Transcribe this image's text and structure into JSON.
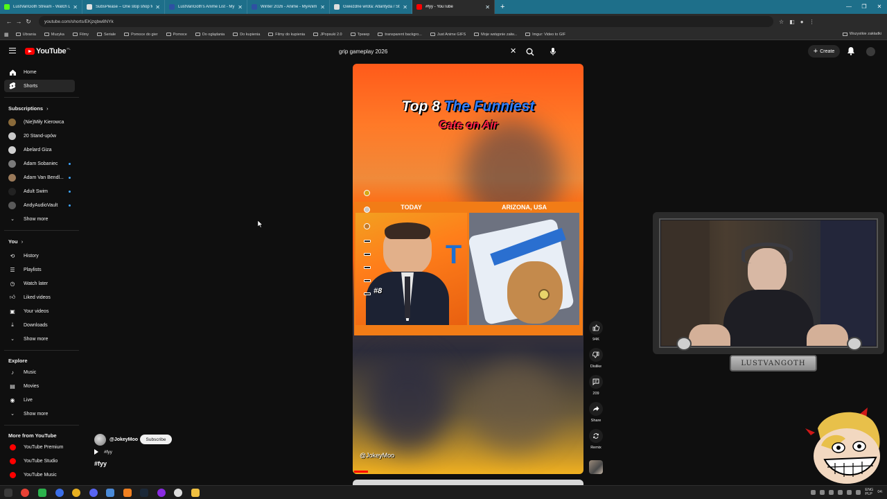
{
  "browser": {
    "tabs": [
      {
        "label": "LustVanGoth Stream - Watch Li",
        "color": "#53fc18"
      },
      {
        "label": "SubsPlease – One stop shop fo",
        "color": "#e0e0e0"
      },
      {
        "label": "LustVanGoth's Anime List - My",
        "color": "#2e51a2"
      },
      {
        "label": "Winter 2026 - Anime - MyAnim",
        "color": "#2e51a2"
      },
      {
        "label": "Gwiezdne wrota: Atlantyda / St",
        "color": "#dddddd"
      },
      {
        "label": "#fyy - YouTube",
        "color": "#ff0000"
      }
    ],
    "url": "youtube.com/shorts/EKjzqbw8NYk",
    "bookmarks": [
      "Ubrania",
      "Muzyka",
      "Filmy",
      "Seriale",
      "Pomoce do gier",
      "Pomoce",
      "Do oglądania",
      "Do kupienia",
      "Filmy do kupienia",
      "JPopsuki 2.0",
      "Трекер",
      "transparent backgro...",
      "Just Anime GIFS",
      "Moje wstępnie załw...",
      "Imgur: Video to GIF"
    ],
    "bookmarks_right": "Wszystkie zakładki"
  },
  "header": {
    "logo_text": "YouTube",
    "logo_country": "PL",
    "search_value": "grip gameplay 2026",
    "create_label": "Create"
  },
  "sidebar": {
    "main": [
      {
        "label": "Home",
        "icon": "home-icon"
      },
      {
        "label": "Shorts",
        "icon": "shorts-icon"
      }
    ],
    "subscriptions_title": "Subscriptions",
    "subscriptions": [
      {
        "label": "(Nie)Miły Kierowca",
        "color": "#8a6a3a",
        "dot": false
      },
      {
        "label": "20 Stand-upów",
        "color": "#c8c8c8",
        "dot": false
      },
      {
        "label": "Abelard Giza",
        "color": "#d0d0d0",
        "dot": false
      },
      {
        "label": "Adam Sobaniec",
        "color": "#7a7a7a",
        "dot": true
      },
      {
        "label": "Adam Van Bendl...",
        "color": "#9a7a5a",
        "dot": true
      },
      {
        "label": "Adult Swim",
        "color": "#222222",
        "dot": true
      },
      {
        "label": "AndyAudioVault",
        "color": "#5a5a5a",
        "dot": true
      }
    ],
    "show_more": "Show more",
    "you_title": "You",
    "you": [
      {
        "label": "History",
        "icon": "history-icon"
      },
      {
        "label": "Playlists",
        "icon": "playlists-icon"
      },
      {
        "label": "Watch later",
        "icon": "watch-later-icon"
      },
      {
        "label": "Liked videos",
        "icon": "liked-icon"
      },
      {
        "label": "Your videos",
        "icon": "your-videos-icon"
      },
      {
        "label": "Downloads",
        "icon": "downloads-icon"
      }
    ],
    "explore_title": "Explore",
    "explore": [
      {
        "label": "Music",
        "icon": "music-icon"
      },
      {
        "label": "Movies",
        "icon": "movies-icon"
      },
      {
        "label": "Live",
        "icon": "live-icon"
      }
    ],
    "more_title": "More from YouTube",
    "more": [
      {
        "label": "YouTube Premium"
      },
      {
        "label": "YouTube Studio"
      },
      {
        "label": "YouTube Music"
      }
    ]
  },
  "short": {
    "title_white": "Top 8",
    "title_blue": "The Funniest",
    "title_red": "Cats on Air",
    "label_left": "TODAY",
    "label_right": "ARIZONA, USA",
    "rank": "#8",
    "handle": "@JokeyMoo",
    "progress": 0.06
  },
  "actions": {
    "likes": "94K",
    "dislike": "Dislike",
    "comments": "209",
    "share": "Share",
    "remix": "Remix"
  },
  "channel": {
    "handle": "@JokeyMoo",
    "subscribe": "Subscribe",
    "tag": "#fyy",
    "title": "#fyy"
  },
  "webcam_label": "LUSTVANGOTH",
  "taskbar": {
    "lang_top": "ENG",
    "lang_bottom": "PLP",
    "time": "04:"
  }
}
